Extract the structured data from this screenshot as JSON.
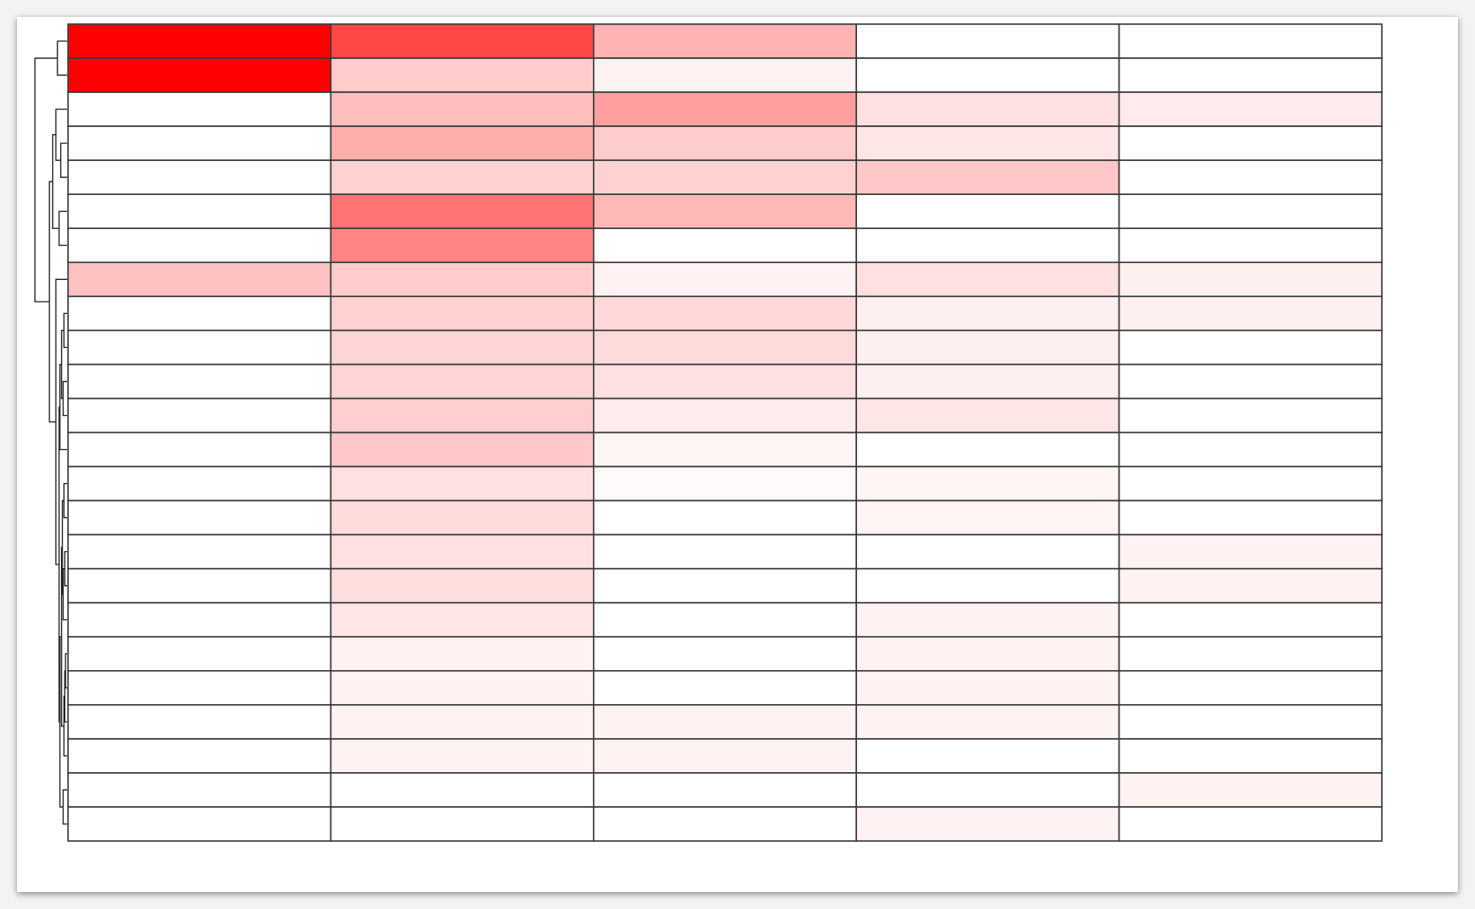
{
  "chart_data": {
    "type": "heatmap",
    "title": "",
    "xlabel": "",
    "ylabel": "",
    "colorscale": {
      "low": "#ffffff",
      "high": "#ff0000"
    },
    "dendrogram": "rows, left side",
    "grid": true,
    "x_tick_labels": [
      "",
      "",
      "",
      "",
      ""
    ],
    "rows": 24,
    "columns": 5,
    "values": [
      [
        1.0,
        0.72,
        0.3,
        0.0,
        0.0
      ],
      [
        1.0,
        0.2,
        0.05,
        0.0,
        0.0
      ],
      [
        0.0,
        0.26,
        0.38,
        0.12,
        0.08
      ],
      [
        0.0,
        0.32,
        0.2,
        0.1,
        0.0
      ],
      [
        0.0,
        0.18,
        0.18,
        0.22,
        0.0
      ],
      [
        0.0,
        0.55,
        0.28,
        0.0,
        0.0
      ],
      [
        0.0,
        0.48,
        0.0,
        0.0,
        0.0
      ],
      [
        0.24,
        0.2,
        0.05,
        0.12,
        0.06
      ],
      [
        0.0,
        0.18,
        0.15,
        0.06,
        0.06
      ],
      [
        0.0,
        0.17,
        0.14,
        0.06,
        0.0
      ],
      [
        0.0,
        0.17,
        0.12,
        0.06,
        0.0
      ],
      [
        0.0,
        0.19,
        0.07,
        0.1,
        0.0
      ],
      [
        0.0,
        0.22,
        0.04,
        0.0,
        0.0
      ],
      [
        0.0,
        0.12,
        0.02,
        0.04,
        0.0
      ],
      [
        0.0,
        0.14,
        0.0,
        0.04,
        0.0
      ],
      [
        0.0,
        0.12,
        0.0,
        0.0,
        0.05
      ],
      [
        0.0,
        0.13,
        0.0,
        0.0,
        0.05
      ],
      [
        0.0,
        0.1,
        0.0,
        0.05,
        0.0
      ],
      [
        0.0,
        0.05,
        0.0,
        0.05,
        0.0
      ],
      [
        0.0,
        0.05,
        0.0,
        0.05,
        0.0
      ],
      [
        0.0,
        0.05,
        0.05,
        0.05,
        0.0
      ],
      [
        0.0,
        0.05,
        0.05,
        0.0,
        0.0
      ],
      [
        0.0,
        0.0,
        0.0,
        0.0,
        0.05
      ],
      [
        0.0,
        0.0,
        0.0,
        0.05,
        0.0
      ]
    ]
  }
}
